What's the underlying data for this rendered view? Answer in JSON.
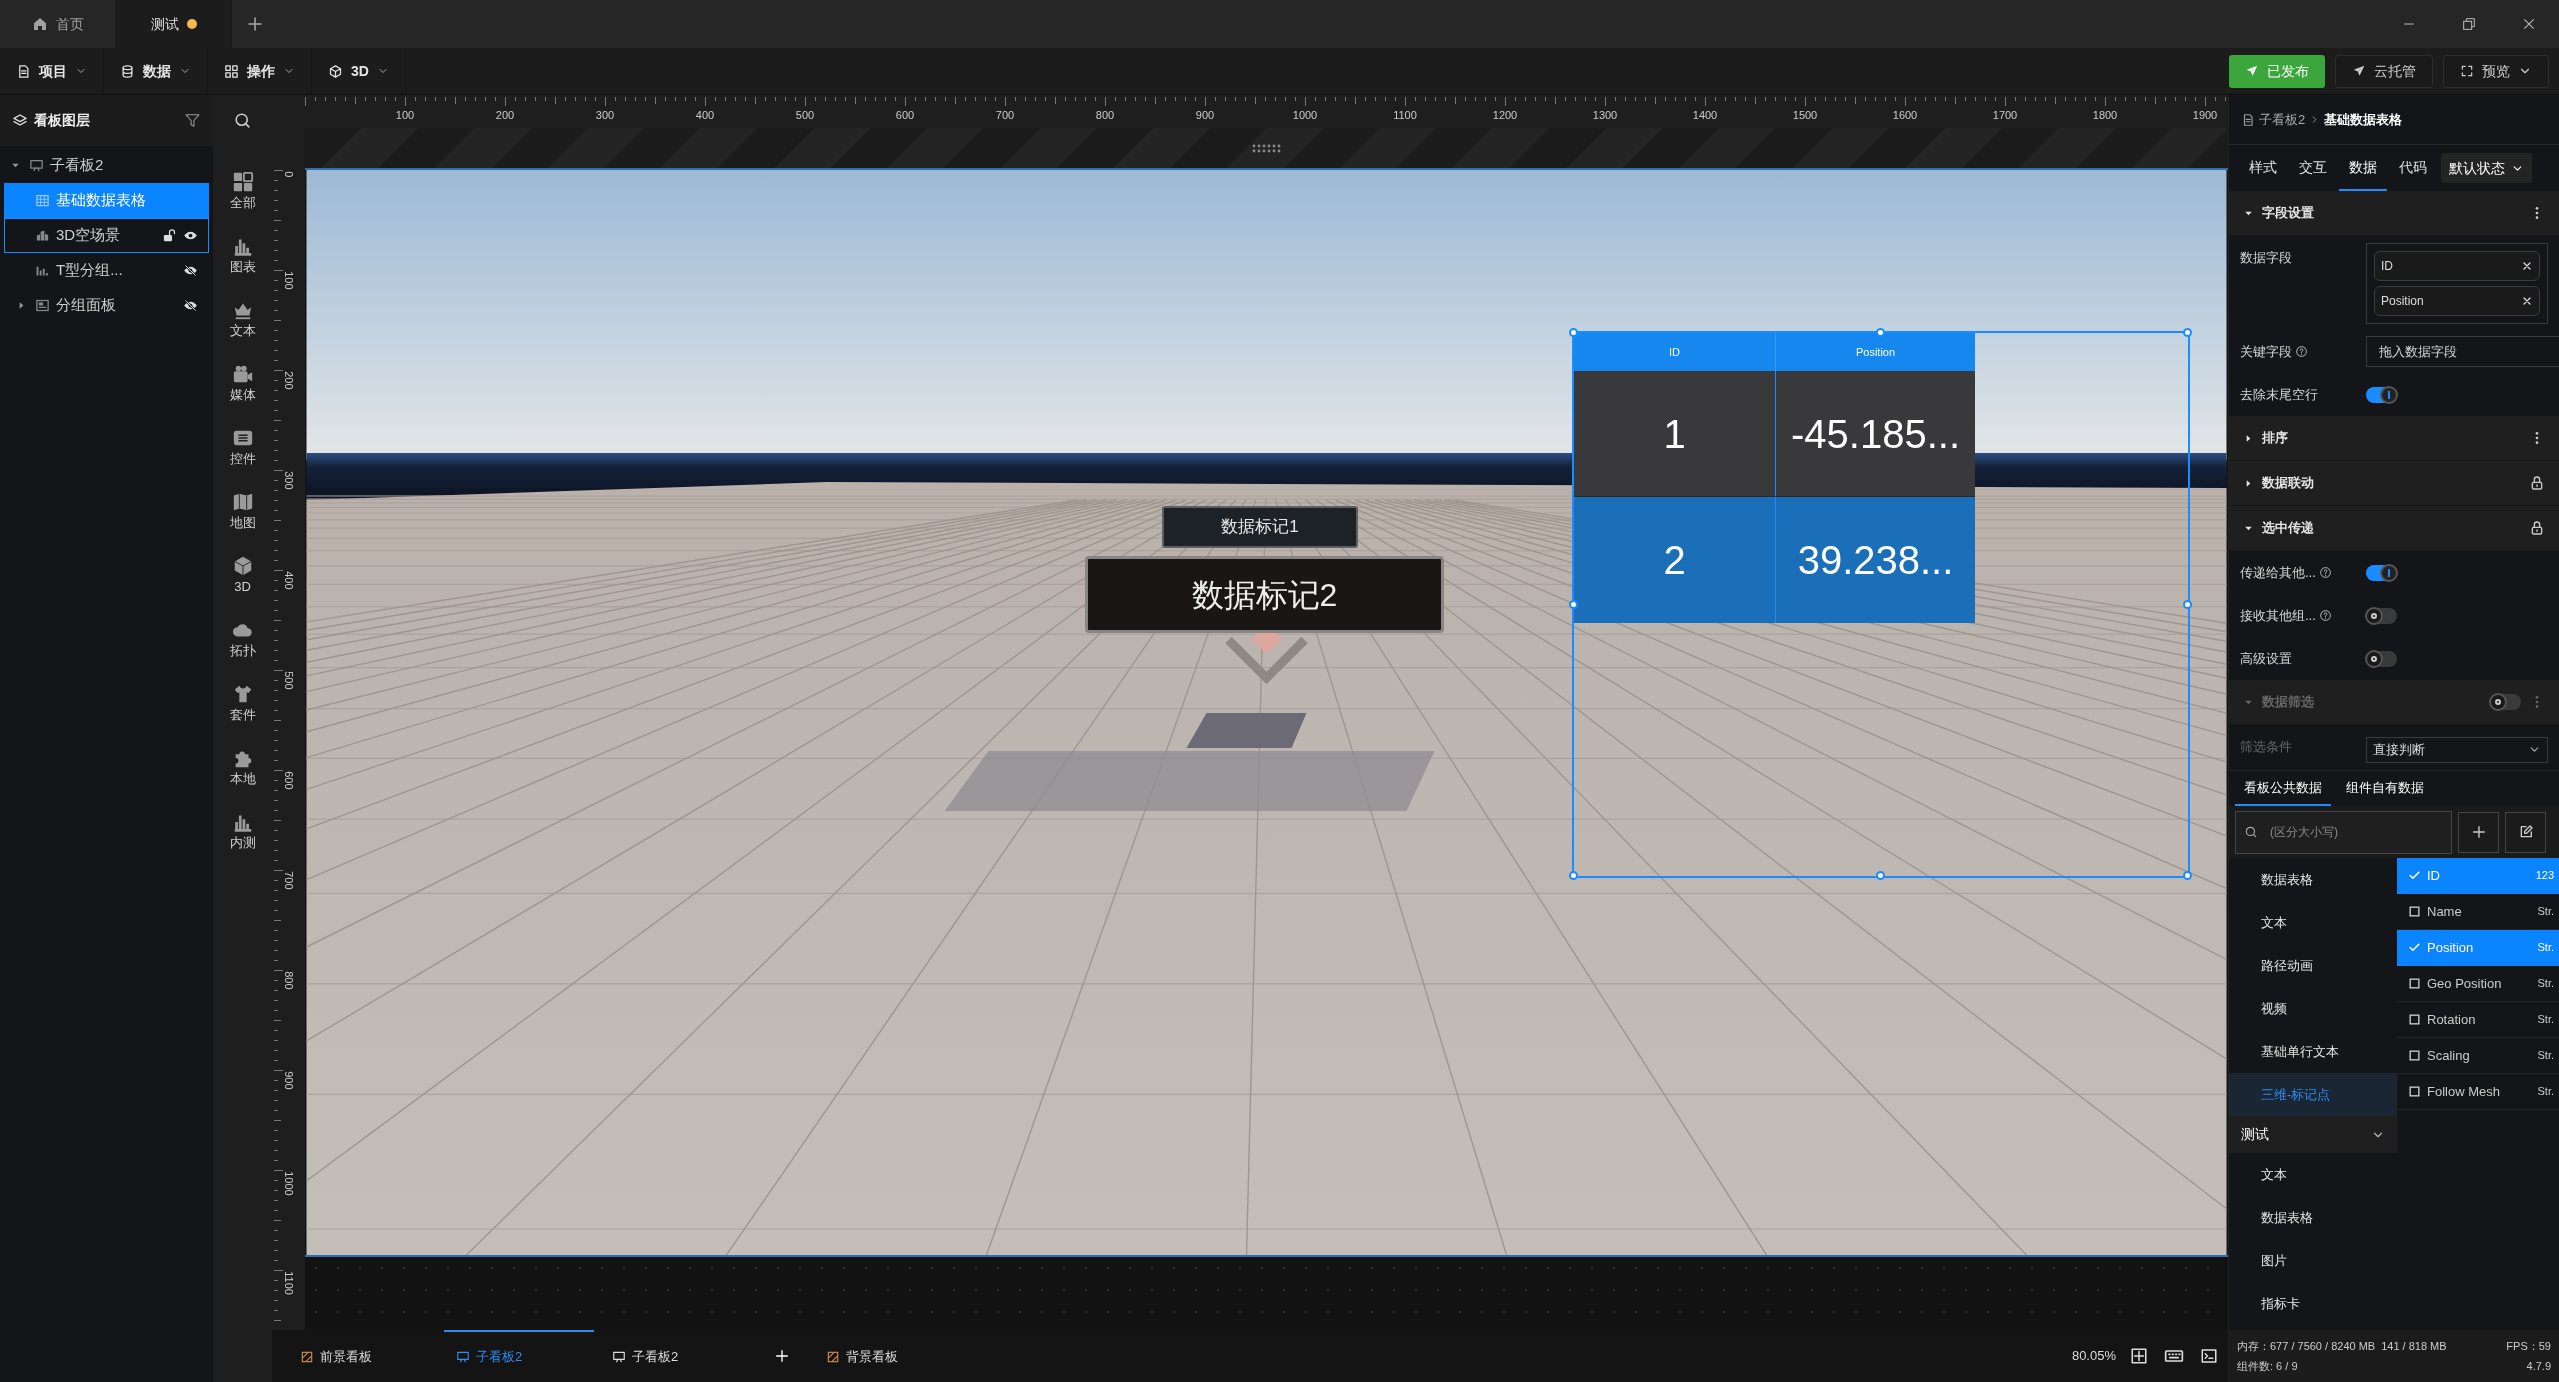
{
  "window_tabs": [
    {
      "label": "首页",
      "kind": "home",
      "selected": false,
      "unsaved": false
    },
    {
      "label": "测试",
      "kind": "doc",
      "selected": true,
      "unsaved": true
    }
  ],
  "menus": [
    "项目",
    "数据",
    "操作",
    "3D"
  ],
  "actions": [
    {
      "label": "已发布",
      "kind": "primary"
    },
    {
      "label": "云托管",
      "kind": "plain"
    },
    {
      "label": "预览",
      "kind": "dropdown"
    }
  ],
  "layers": {
    "title": "看板图层",
    "items": [
      {
        "label": "子看板2",
        "kind": "board",
        "selected": false,
        "hovered": false,
        "expanded": true,
        "children": [
          {
            "label": "基础数据表格",
            "kind": "table",
            "selected": true,
            "hovered": false
          },
          {
            "label": "3D空场景",
            "kind": "scene",
            "selected": false,
            "hovered": true,
            "locked": false,
            "visible": true
          },
          {
            "label": "T型分组...",
            "kind": "chart",
            "selected": false,
            "hovered": false,
            "visible": false
          },
          {
            "label": "分组面板",
            "kind": "group",
            "selected": false,
            "hovered": false,
            "visible": false,
            "expanded": false
          }
        ]
      }
    ]
  },
  "component_categories": [
    "全部",
    "图表",
    "文本",
    "媒体",
    "控件",
    "地图",
    "3D",
    "拓扑",
    "套件",
    "本地",
    "内测"
  ],
  "rulers": {
    "horizontal": [
      "100",
      "200",
      "300",
      "400",
      "500",
      "600",
      "700",
      "800",
      "900",
      "1000",
      "1100",
      "1200",
      "1300",
      "1400",
      "1500",
      "1600",
      "1700",
      "1800",
      "1900"
    ],
    "vertical": [
      "0",
      "100",
      "200",
      "300",
      "400",
      "500",
      "600",
      "700",
      "800",
      "900",
      "1000",
      "1100"
    ]
  },
  "canvas": {
    "markers": [
      "数据标记1",
      "数据标记2"
    ],
    "table": {
      "columns": [
        "ID",
        "Position"
      ],
      "rows": [
        {
          "cells": [
            "1",
            "-45.185..."
          ],
          "selected": false
        },
        {
          "cells": [
            "2",
            "39.238..."
          ],
          "selected": true
        }
      ]
    }
  },
  "bottom_bar": {
    "boards": [
      {
        "label": "前景看板",
        "kind": "foreground",
        "selected": false
      },
      {
        "label": "子看板2",
        "kind": "sub",
        "selected": true
      },
      {
        "label": "子看板2",
        "kind": "sub",
        "selected": false
      },
      {
        "label": "背景看板",
        "kind": "background",
        "selected": false
      }
    ],
    "zoom": "80.05%"
  },
  "inspector": {
    "breadcrumb": [
      "子看板2",
      "基础数据表格"
    ],
    "tabs": [
      {
        "label": "样式",
        "selected": false
      },
      {
        "label": "交互",
        "selected": false
      },
      {
        "label": "数据",
        "selected": true
      },
      {
        "label": "代码",
        "selected": false
      }
    ],
    "state_select": "默认状态",
    "sections": [
      {
        "title": "字段设置",
        "expanded": true,
        "locked": false,
        "disabled": false,
        "rows": [
          {
            "kind": "chips",
            "label": "数据字段",
            "chips": [
              "ID",
              "Position"
            ]
          },
          {
            "kind": "input",
            "label": "关键字段",
            "help": true,
            "placeholder": "拖入数据字段"
          },
          {
            "kind": "toggle",
            "label": "去除末尾空行",
            "help": false,
            "on": true
          }
        ]
      },
      {
        "title": "排序",
        "expanded": false,
        "locked": false,
        "disabled": false
      },
      {
        "title": "数据联动",
        "expanded": false,
        "locked": true,
        "disabled": false
      },
      {
        "title": "选中传递",
        "expanded": true,
        "locked": true,
        "disabled": false,
        "rows": [
          {
            "kind": "toggle",
            "label": "传递给其他...",
            "help": true,
            "on": true
          },
          {
            "kind": "toggle",
            "label": "接收其他组...",
            "help": true,
            "on": false
          },
          {
            "kind": "toggle",
            "label": "高级设置",
            "help": false,
            "on": false
          }
        ]
      },
      {
        "title": "数据筛选",
        "expanded": true,
        "locked": false,
        "disabled": true,
        "on": false,
        "rows": [
          {
            "kind": "select",
            "label": "筛选条件",
            "value": "直接判断"
          }
        ]
      }
    ],
    "data_tabs": [
      {
        "label": "看板公共数据",
        "selected": true
      },
      {
        "label": "组件自有数据",
        "selected": false
      }
    ],
    "search": {
      "placeholder": "(区分大小写)"
    },
    "groups": [
      {
        "items": [
          {
            "label": "数据表格",
            "selected": false
          },
          {
            "label": "文本",
            "selected": false
          },
          {
            "label": "路径动画",
            "selected": false
          },
          {
            "label": "视频",
            "selected": false
          },
          {
            "label": "基础单行文本",
            "selected": false
          },
          {
            "label": "三维-标记点",
            "selected": true
          }
        ]
      },
      {
        "title": "测试",
        "expanded": true,
        "items": [
          {
            "label": "文本",
            "selected": false
          },
          {
            "label": "数据表格",
            "selected": false
          },
          {
            "label": "图片",
            "selected": false
          },
          {
            "label": "指标卡",
            "selected": false
          }
        ]
      }
    ],
    "fields": [
      {
        "name": "ID",
        "type": "123",
        "checked": true
      },
      {
        "name": "Name",
        "type": "Str.",
        "checked": false
      },
      {
        "name": "Position",
        "type": "Str.",
        "checked": true
      },
      {
        "name": "Geo Position",
        "type": "Str.",
        "checked": false
      },
      {
        "name": "Rotation",
        "type": "Str.",
        "checked": false
      },
      {
        "name": "Scaling",
        "type": "Str.",
        "checked": false
      },
      {
        "name": "Follow Mesh",
        "type": "Str.",
        "checked": false
      }
    ]
  },
  "status_bar": {
    "memory": "内存：677 / 7560 / 8240 MB",
    "gpu_memory": "141 / 818 MB",
    "fps": "FPS：59",
    "components": "组件数: 6 / 9",
    "version": "4.7.9"
  }
}
